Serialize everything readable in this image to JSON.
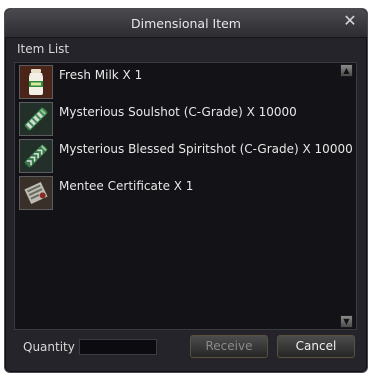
{
  "window": {
    "title": "Dimensional Item"
  },
  "list": {
    "header": "Item List",
    "items": [
      {
        "label": "Fresh Milk X 1",
        "icon": "milk-bottle-icon"
      },
      {
        "label": "Mysterious Soulshot (C-Grade) X 10000",
        "icon": "soulshot-icon"
      },
      {
        "label": "Mysterious Blessed Spiritshot (C-Grade) X 10000",
        "icon": "spiritshot-icon"
      },
      {
        "label": "Mentee Certificate X 1",
        "icon": "certificate-icon"
      }
    ]
  },
  "footer": {
    "quantity_label": "Quantity",
    "quantity_value": "",
    "receive_label": "Receive",
    "cancel_label": "Cancel"
  },
  "colors": {
    "window_bg": "#24242a",
    "list_bg": "#121217",
    "text": "#e8e8e8",
    "disabled_text": "#8a8a8a"
  }
}
